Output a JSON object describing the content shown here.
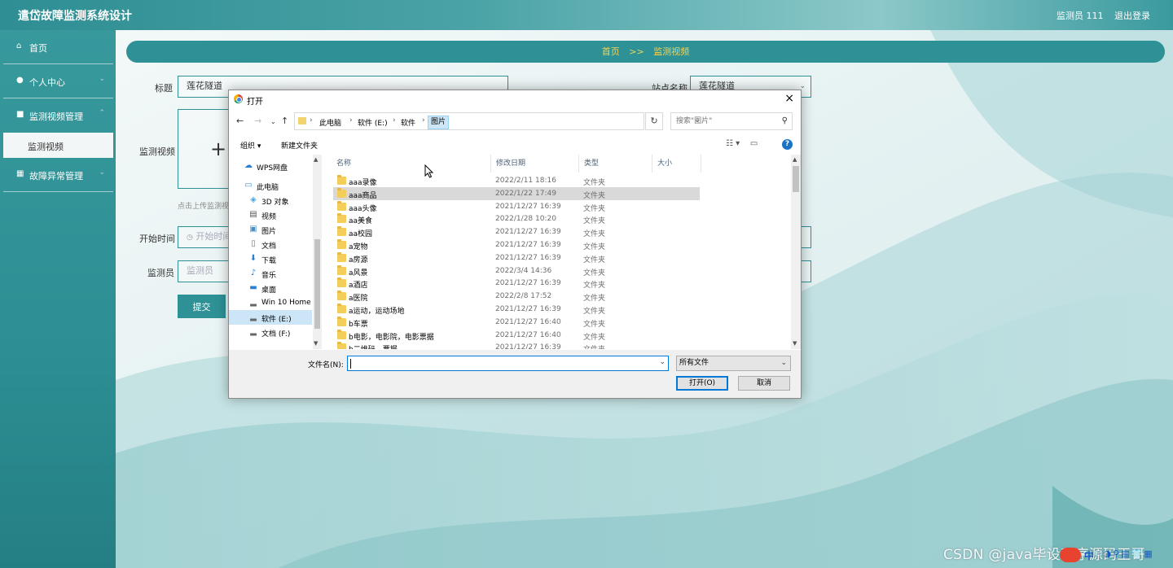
{
  "app": {
    "title": "遣岱故障监测系统设计",
    "user_label": "监测员 111",
    "logout_label": "退出登录"
  },
  "sidebar": {
    "items": [
      {
        "label": "首页",
        "icon": "home-icon"
      },
      {
        "label": "个人中心",
        "icon": "user-icon"
      },
      {
        "label": "监测视频管理",
        "icon": "video-icon"
      },
      {
        "label": "故障异常管理",
        "icon": "grid-icon"
      }
    ],
    "submenu_active": "监测视频"
  },
  "breadcrumb": {
    "home": "首页",
    "sep": ">>",
    "current": "监测视频"
  },
  "form": {
    "title_label": "标题",
    "title_value": "莲花隧道",
    "station_label": "站点名称",
    "station_value": "莲花隧道",
    "video_label": "监测视频",
    "upload_plus": "+",
    "upload_tip": "点击上传监测视频",
    "start_label": "开始时间",
    "start_placeholder": "开始时间",
    "monitor_label": "监测员",
    "monitor_placeholder": "监测员",
    "submit_label": "提交"
  },
  "dialog": {
    "title": "打开",
    "close": "×",
    "path": [
      "此电脑",
      "软件 (E:)",
      "软件",
      "图片"
    ],
    "search_placeholder": "搜索\"图片\"",
    "organize_label": "组织 ▾",
    "new_folder_label": "新建文件夹",
    "nav_items": [
      {
        "label": "WPS网盘",
        "icon": "cloud-icon"
      },
      {
        "label": "此电脑",
        "icon": "computer-icon"
      },
      {
        "label": "3D 对象",
        "icon": "cube-icon"
      },
      {
        "label": "视频",
        "icon": "video-folder-icon"
      },
      {
        "label": "图片",
        "icon": "picture-folder-icon"
      },
      {
        "label": "文档",
        "icon": "document-icon"
      },
      {
        "label": "下载",
        "icon": "download-icon"
      },
      {
        "label": "音乐",
        "icon": "music-icon"
      },
      {
        "label": "桌面",
        "icon": "desktop-icon"
      },
      {
        "label": "Win 10 Home",
        "icon": "drive-icon"
      },
      {
        "label": "软件 (E:)",
        "icon": "drive-icon"
      },
      {
        "label": "文档 (F:)",
        "icon": "drive-icon"
      }
    ],
    "selected_nav_index": 10,
    "columns": [
      "名称",
      "修改日期",
      "类型",
      "大小"
    ],
    "files": [
      {
        "name": "aaa录像",
        "date": "2022/2/11 18:16",
        "type": "文件夹"
      },
      {
        "name": "aaa商品",
        "date": "2022/1/22 17:49",
        "type": "文件夹"
      },
      {
        "name": "aaa头像",
        "date": "2021/12/27 16:39",
        "type": "文件夹"
      },
      {
        "name": "aa美食",
        "date": "2022/1/28 10:20",
        "type": "文件夹"
      },
      {
        "name": "aa校园",
        "date": "2021/12/27 16:39",
        "type": "文件夹"
      },
      {
        "name": "a宠物",
        "date": "2021/12/27 16:39",
        "type": "文件夹"
      },
      {
        "name": "a房源",
        "date": "2021/12/27 16:39",
        "type": "文件夹"
      },
      {
        "name": "a风景",
        "date": "2022/3/4 14:36",
        "type": "文件夹"
      },
      {
        "name": "a酒店",
        "date": "2021/12/27 16:39",
        "type": "文件夹"
      },
      {
        "name": "a医院",
        "date": "2022/2/8 17:52",
        "type": "文件夹"
      },
      {
        "name": "a运动，运动场地",
        "date": "2021/12/27 16:39",
        "type": "文件夹"
      },
      {
        "name": "b车票",
        "date": "2021/12/27 16:40",
        "type": "文件夹"
      },
      {
        "name": "b电影，电影院，电影票据",
        "date": "2021/12/27 16:40",
        "type": "文件夹"
      },
      {
        "name": "b二维码，票据",
        "date": "2021/12/27 16:39",
        "type": "文件夹"
      }
    ],
    "highlighted_file_index": 1,
    "filename_label": "文件名(N):",
    "filename_value": "",
    "filter_value": "所有文件",
    "open_label": "打开(O)",
    "cancel_label": "取消"
  },
  "watermark": "CSDN @java毕设程序源码王哥",
  "ime": {
    "label": "中"
  },
  "colors": {
    "primary": "#2e9196",
    "breadcrumb_text": "#f0d55a",
    "sidebar": "#2c8f93"
  }
}
